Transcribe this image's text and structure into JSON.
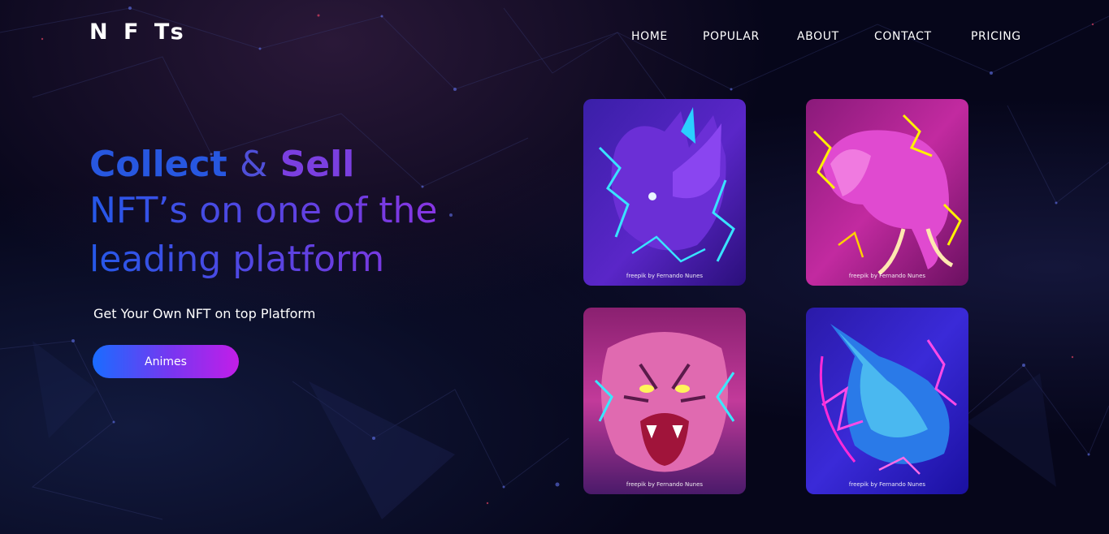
{
  "brand": "N F Ts",
  "nav": [
    {
      "label": "HOME"
    },
    {
      "label": "POPULAR"
    },
    {
      "label": "ABOUT"
    },
    {
      "label": "CONTACT"
    },
    {
      "label": "PRICING"
    }
  ],
  "hero": {
    "word_collect": "Collect",
    "word_amp": "&",
    "word_sell": "Sell",
    "line2": "NFT’s on one of the",
    "line3": "leading platform",
    "subtitle": "Get Your Own NFT on top Platform",
    "button_label": "Animes"
  },
  "cards": [
    {
      "animal": "rhino",
      "credit": "freepik by Fernando Nunes"
    },
    {
      "animal": "elephant",
      "credit": "freepik by Fernando Nunes"
    },
    {
      "animal": "tiger",
      "credit": "freepik by Fernando Nunes"
    },
    {
      "animal": "wolf",
      "credit": "freepik by Fernando Nunes"
    }
  ],
  "colors": {
    "background": "#06061a",
    "accent_blue": "#1a6cff",
    "accent_purple": "#7a35f0",
    "accent_magenta": "#c21ee8"
  }
}
